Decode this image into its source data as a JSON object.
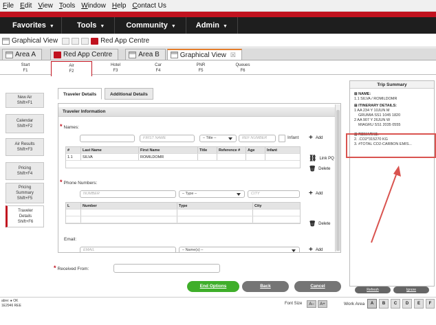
{
  "menu": [
    "File",
    "Edit",
    "View",
    "Tools",
    "Window",
    "Help",
    "Contact Us"
  ],
  "nav": [
    {
      "label": "Favorites"
    },
    {
      "label": "Tools"
    },
    {
      "label": "Community"
    },
    {
      "label": "Admin"
    }
  ],
  "toolbar": {
    "graphical_view": "Graphical View",
    "red_app": "Red App Centre"
  },
  "tabs": [
    {
      "label": "Area A"
    },
    {
      "label": "Red App Centre"
    },
    {
      "label": "Area B"
    },
    {
      "label": "Graphical View"
    }
  ],
  "fkeys": [
    {
      "name": "Start",
      "key": "F1"
    },
    {
      "name": "Air",
      "key": "F2"
    },
    {
      "name": "Hotel",
      "key": "F3"
    },
    {
      "name": "Car",
      "key": "F4"
    },
    {
      "name": "PNR",
      "key": "F5"
    },
    {
      "name": "Queues",
      "key": "F6"
    }
  ],
  "leftnav": [
    {
      "line1": "New Air",
      "line2": "Shift+F1"
    },
    {
      "line1": "Calendar",
      "line2": "Shift+F2"
    },
    {
      "line1": "Air Results",
      "line2": "Shift+F3"
    },
    {
      "line1": "Pricing",
      "line2": "Shift+F4"
    },
    {
      "line1": "Pricing",
      "line2": "Summary",
      "line3": "Shift+F5"
    },
    {
      "line1": "Traveler",
      "line2": "Details",
      "line3": "Shift+F6"
    }
  ],
  "subtabs": {
    "traveler": "Traveler Details",
    "additional": "Additional Details"
  },
  "form": {
    "section": "Traveler Information",
    "names_label": "Names:",
    "first_name_ph": "FIRST NAME",
    "title_sel": "– Title –",
    "ref_ph": "REF NUMBER",
    "infant": "Infant",
    "add": "Add",
    "linkpq": "Link PQ",
    "delete": "Delete",
    "names_cols": [
      "#",
      "Last Name",
      "First Name",
      "Title",
      "Reference #",
      "Age",
      "Infant"
    ],
    "names_row": [
      "1.1",
      "SILVA",
      "ROMILDOMR",
      "",
      "",
      "",
      ""
    ],
    "phone_label": "Phone Numbers:",
    "number_ph": "NUMBER",
    "type_sel": "– Type –",
    "city_ph": "CITY",
    "phone_cols": [
      "L",
      "Number",
      "Type",
      "City"
    ],
    "email_label": "Email:",
    "email_ph": "EMAIL",
    "names_sel": "– Name(s) –",
    "received_label": "Received From:"
  },
  "buttons": {
    "end": "End Options",
    "back": "Back",
    "cancel": "Cancel"
  },
  "summary": {
    "title": "Trip Summary",
    "name_head": "NAME:",
    "name_line": "1.1 SILVA / ROMILDOMR",
    "itin_head": "ITINERARY DETAILS:",
    "itin": [
      "1 AA 234 Y 10JUN M",
      "GRUMIA SS1 1045 1820",
      "2 AA 907 Y 26JUN W",
      "MIAGRU SS1 2035 0555"
    ],
    "remarks_head": "REMARKS:",
    "remarks": [
      "2. .CO2*315270 KG",
      "3. #TOTAL CO2-CARBON EMIS..."
    ],
    "refresh": "Refresh",
    "ignore": "Ignore"
  },
  "status": {
    "line1": "abre: ● OK",
    "line2": "1E2946 REE",
    "font_size": "Font Size",
    "a_minus": "A–",
    "a_plus": "A+",
    "work_area": "Work Area",
    "areas": [
      "A",
      "B",
      "C",
      "D",
      "E",
      "F"
    ]
  }
}
